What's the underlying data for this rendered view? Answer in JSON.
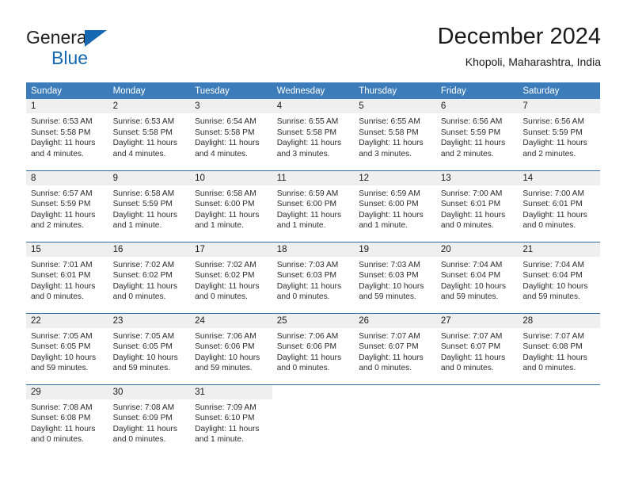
{
  "logo": {
    "word1": "General",
    "word2": "Blue",
    "triangle_color": "#1668b3"
  },
  "header": {
    "title": "December 2024",
    "subtitle": "Khopoli, Maharashtra, India"
  },
  "theme": {
    "header_blue": "#3d7cba",
    "row_divider_blue": "#2e6ca4",
    "daynum_gray": "#efefef"
  },
  "weekday_headers": [
    "Sunday",
    "Monday",
    "Tuesday",
    "Wednesday",
    "Thursday",
    "Friday",
    "Saturday"
  ],
  "weeks": [
    [
      {
        "day": "1",
        "sunrise": "Sunrise: 6:53 AM",
        "sunset": "Sunset: 5:58 PM",
        "daylight1": "Daylight: 11 hours",
        "daylight2": "and 4 minutes."
      },
      {
        "day": "2",
        "sunrise": "Sunrise: 6:53 AM",
        "sunset": "Sunset: 5:58 PM",
        "daylight1": "Daylight: 11 hours",
        "daylight2": "and 4 minutes."
      },
      {
        "day": "3",
        "sunrise": "Sunrise: 6:54 AM",
        "sunset": "Sunset: 5:58 PM",
        "daylight1": "Daylight: 11 hours",
        "daylight2": "and 4 minutes."
      },
      {
        "day": "4",
        "sunrise": "Sunrise: 6:55 AM",
        "sunset": "Sunset: 5:58 PM",
        "daylight1": "Daylight: 11 hours",
        "daylight2": "and 3 minutes."
      },
      {
        "day": "5",
        "sunrise": "Sunrise: 6:55 AM",
        "sunset": "Sunset: 5:58 PM",
        "daylight1": "Daylight: 11 hours",
        "daylight2": "and 3 minutes."
      },
      {
        "day": "6",
        "sunrise": "Sunrise: 6:56 AM",
        "sunset": "Sunset: 5:59 PM",
        "daylight1": "Daylight: 11 hours",
        "daylight2": "and 2 minutes."
      },
      {
        "day": "7",
        "sunrise": "Sunrise: 6:56 AM",
        "sunset": "Sunset: 5:59 PM",
        "daylight1": "Daylight: 11 hours",
        "daylight2": "and 2 minutes."
      }
    ],
    [
      {
        "day": "8",
        "sunrise": "Sunrise: 6:57 AM",
        "sunset": "Sunset: 5:59 PM",
        "daylight1": "Daylight: 11 hours",
        "daylight2": "and 2 minutes."
      },
      {
        "day": "9",
        "sunrise": "Sunrise: 6:58 AM",
        "sunset": "Sunset: 5:59 PM",
        "daylight1": "Daylight: 11 hours",
        "daylight2": "and 1 minute."
      },
      {
        "day": "10",
        "sunrise": "Sunrise: 6:58 AM",
        "sunset": "Sunset: 6:00 PM",
        "daylight1": "Daylight: 11 hours",
        "daylight2": "and 1 minute."
      },
      {
        "day": "11",
        "sunrise": "Sunrise: 6:59 AM",
        "sunset": "Sunset: 6:00 PM",
        "daylight1": "Daylight: 11 hours",
        "daylight2": "and 1 minute."
      },
      {
        "day": "12",
        "sunrise": "Sunrise: 6:59 AM",
        "sunset": "Sunset: 6:00 PM",
        "daylight1": "Daylight: 11 hours",
        "daylight2": "and 1 minute."
      },
      {
        "day": "13",
        "sunrise": "Sunrise: 7:00 AM",
        "sunset": "Sunset: 6:01 PM",
        "daylight1": "Daylight: 11 hours",
        "daylight2": "and 0 minutes."
      },
      {
        "day": "14",
        "sunrise": "Sunrise: 7:00 AM",
        "sunset": "Sunset: 6:01 PM",
        "daylight1": "Daylight: 11 hours",
        "daylight2": "and 0 minutes."
      }
    ],
    [
      {
        "day": "15",
        "sunrise": "Sunrise: 7:01 AM",
        "sunset": "Sunset: 6:01 PM",
        "daylight1": "Daylight: 11 hours",
        "daylight2": "and 0 minutes."
      },
      {
        "day": "16",
        "sunrise": "Sunrise: 7:02 AM",
        "sunset": "Sunset: 6:02 PM",
        "daylight1": "Daylight: 11 hours",
        "daylight2": "and 0 minutes."
      },
      {
        "day": "17",
        "sunrise": "Sunrise: 7:02 AM",
        "sunset": "Sunset: 6:02 PM",
        "daylight1": "Daylight: 11 hours",
        "daylight2": "and 0 minutes."
      },
      {
        "day": "18",
        "sunrise": "Sunrise: 7:03 AM",
        "sunset": "Sunset: 6:03 PM",
        "daylight1": "Daylight: 11 hours",
        "daylight2": "and 0 minutes."
      },
      {
        "day": "19",
        "sunrise": "Sunrise: 7:03 AM",
        "sunset": "Sunset: 6:03 PM",
        "daylight1": "Daylight: 10 hours",
        "daylight2": "and 59 minutes."
      },
      {
        "day": "20",
        "sunrise": "Sunrise: 7:04 AM",
        "sunset": "Sunset: 6:04 PM",
        "daylight1": "Daylight: 10 hours",
        "daylight2": "and 59 minutes."
      },
      {
        "day": "21",
        "sunrise": "Sunrise: 7:04 AM",
        "sunset": "Sunset: 6:04 PM",
        "daylight1": "Daylight: 10 hours",
        "daylight2": "and 59 minutes."
      }
    ],
    [
      {
        "day": "22",
        "sunrise": "Sunrise: 7:05 AM",
        "sunset": "Sunset: 6:05 PM",
        "daylight1": "Daylight: 10 hours",
        "daylight2": "and 59 minutes."
      },
      {
        "day": "23",
        "sunrise": "Sunrise: 7:05 AM",
        "sunset": "Sunset: 6:05 PM",
        "daylight1": "Daylight: 10 hours",
        "daylight2": "and 59 minutes."
      },
      {
        "day": "24",
        "sunrise": "Sunrise: 7:06 AM",
        "sunset": "Sunset: 6:06 PM",
        "daylight1": "Daylight: 10 hours",
        "daylight2": "and 59 minutes."
      },
      {
        "day": "25",
        "sunrise": "Sunrise: 7:06 AM",
        "sunset": "Sunset: 6:06 PM",
        "daylight1": "Daylight: 11 hours",
        "daylight2": "and 0 minutes."
      },
      {
        "day": "26",
        "sunrise": "Sunrise: 7:07 AM",
        "sunset": "Sunset: 6:07 PM",
        "daylight1": "Daylight: 11 hours",
        "daylight2": "and 0 minutes."
      },
      {
        "day": "27",
        "sunrise": "Sunrise: 7:07 AM",
        "sunset": "Sunset: 6:07 PM",
        "daylight1": "Daylight: 11 hours",
        "daylight2": "and 0 minutes."
      },
      {
        "day": "28",
        "sunrise": "Sunrise: 7:07 AM",
        "sunset": "Sunset: 6:08 PM",
        "daylight1": "Daylight: 11 hours",
        "daylight2": "and 0 minutes."
      }
    ],
    [
      {
        "day": "29",
        "sunrise": "Sunrise: 7:08 AM",
        "sunset": "Sunset: 6:08 PM",
        "daylight1": "Daylight: 11 hours",
        "daylight2": "and 0 minutes."
      },
      {
        "day": "30",
        "sunrise": "Sunrise: 7:08 AM",
        "sunset": "Sunset: 6:09 PM",
        "daylight1": "Daylight: 11 hours",
        "daylight2": "and 0 minutes."
      },
      {
        "day": "31",
        "sunrise": "Sunrise: 7:09 AM",
        "sunset": "Sunset: 6:10 PM",
        "daylight1": "Daylight: 11 hours",
        "daylight2": "and 1 minute."
      },
      {
        "day": "",
        "sunrise": "",
        "sunset": "",
        "daylight1": "",
        "daylight2": ""
      },
      {
        "day": "",
        "sunrise": "",
        "sunset": "",
        "daylight1": "",
        "daylight2": ""
      },
      {
        "day": "",
        "sunrise": "",
        "sunset": "",
        "daylight1": "",
        "daylight2": ""
      },
      {
        "day": "",
        "sunrise": "",
        "sunset": "",
        "daylight1": "",
        "daylight2": ""
      }
    ]
  ]
}
